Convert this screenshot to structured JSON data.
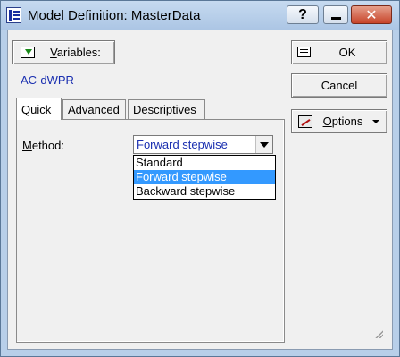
{
  "window": {
    "title": "Model Definition: MasterData",
    "help_glyph": "?",
    "close_glyph": "✕"
  },
  "buttons": {
    "variables_label": "Variables:",
    "variables_hotkey": "V",
    "ok_label": "OK",
    "cancel_label": "Cancel",
    "options_label": "Options",
    "options_hotkey": "O"
  },
  "dataset": {
    "selected_variable": "AC-dWPR"
  },
  "tabs": [
    {
      "label": "Quick",
      "active": true
    },
    {
      "label": "Advanced",
      "active": false
    },
    {
      "label": "Descriptives",
      "active": false
    }
  ],
  "quick": {
    "method_label": "Method:",
    "method_hotkey": "M",
    "method_value": "Forward stepwise",
    "method_options": [
      {
        "label": "Standard",
        "selected": false
      },
      {
        "label": "Forward stepwise",
        "selected": true
      },
      {
        "label": "Backward stepwise",
        "selected": false
      }
    ]
  },
  "icons": {
    "app": "app-window-icon",
    "variables": "variables-icon",
    "ok": "ok-icon",
    "options": "options-icon"
  },
  "colors": {
    "accent_blue_text": "#1a2fb0",
    "selection_highlight": "#3399ff",
    "close_button": "#c7442a"
  }
}
